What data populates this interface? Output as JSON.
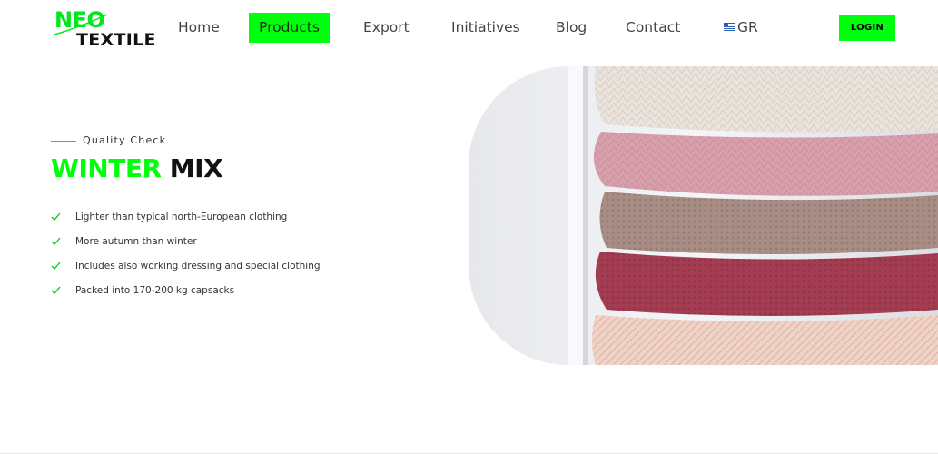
{
  "brand": {
    "line1": "NEO",
    "line2": "TEXTILE"
  },
  "nav": {
    "items": [
      {
        "label": "Home"
      },
      {
        "label": "Products"
      },
      {
        "label": "Export"
      },
      {
        "label": "Initiatives"
      },
      {
        "label": "Blog"
      },
      {
        "label": "Contact"
      }
    ],
    "active_item": "Products",
    "language": {
      "label": "GR",
      "flag_icon": "greek-flag-icon"
    },
    "login_label": "LOGIN"
  },
  "section": {
    "eyebrow": "Quality Check",
    "title_highlight": "WINTER",
    "title_rest": "MIX",
    "features": [
      "Lighter than typical north-European clothing",
      "More autumn than winter",
      "Includes also working dressing and special clothing",
      "Packed into 170-200 kg capsacks"
    ],
    "feature_icon": "check-icon"
  },
  "hero_image": {
    "subject": "stacked-knitted-sweaters-image"
  },
  "colors": {
    "accent": "#00ff0c",
    "text": "#111111",
    "muted": "#444444"
  }
}
